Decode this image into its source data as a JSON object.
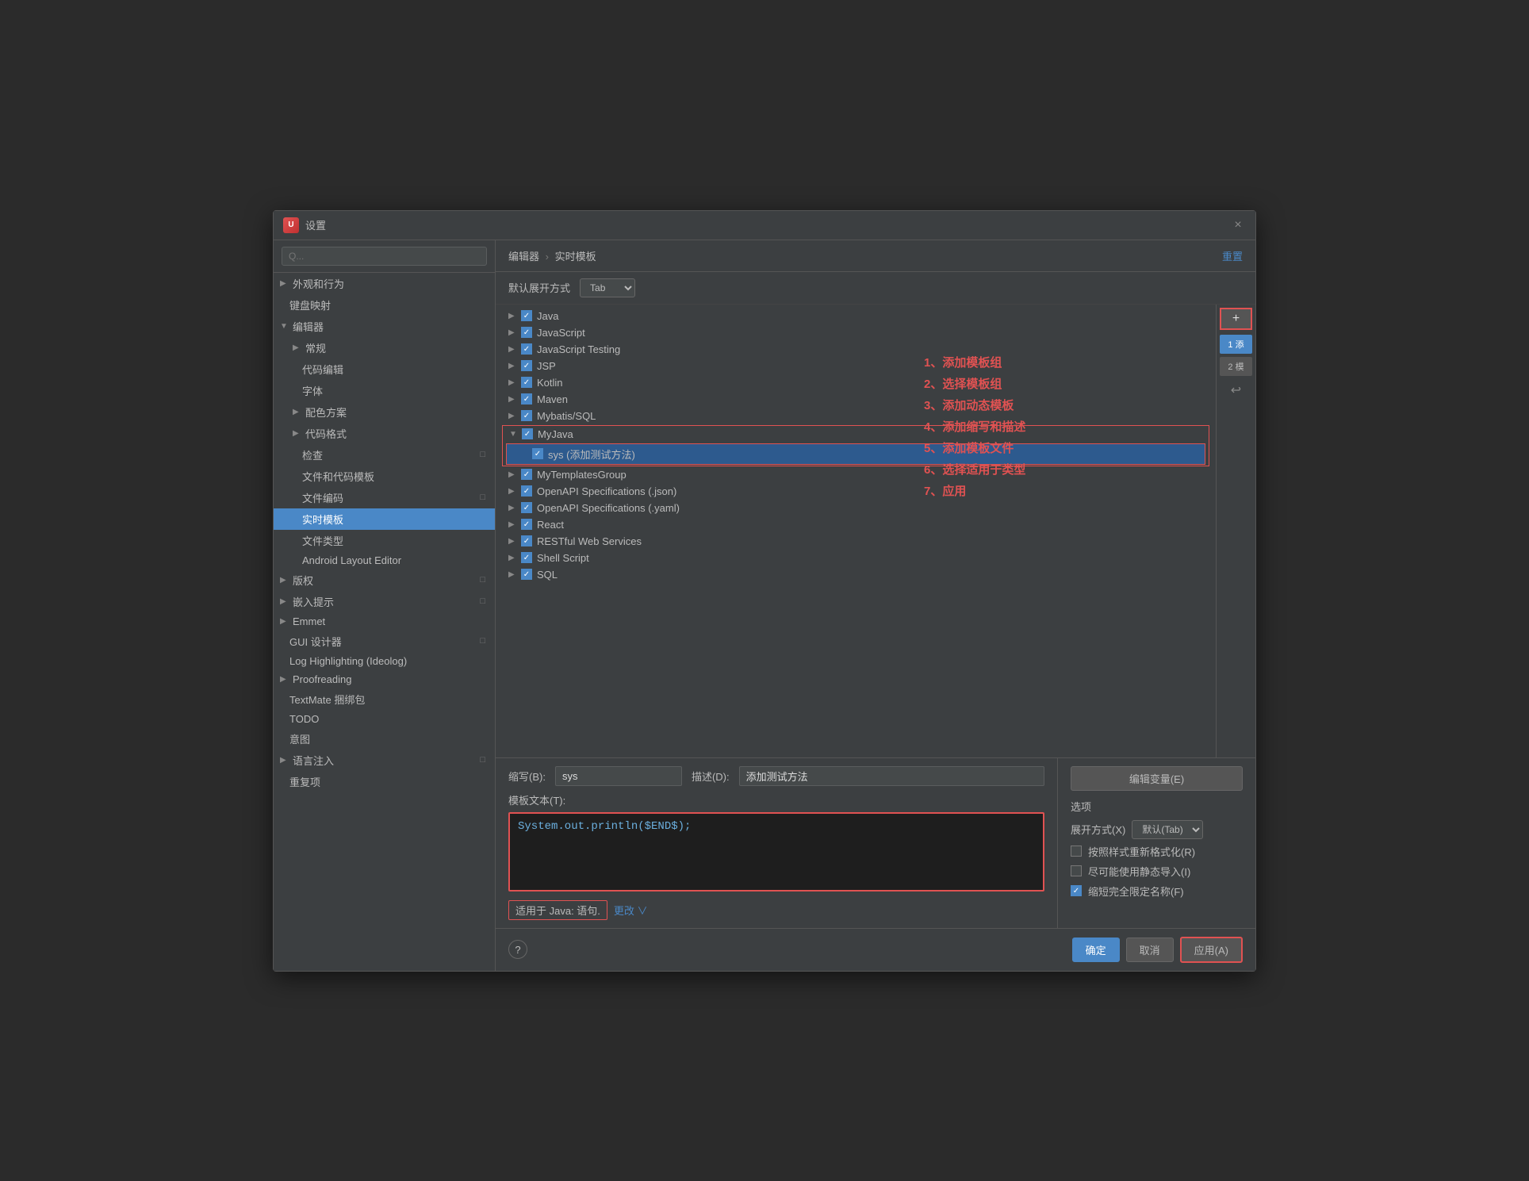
{
  "dialog": {
    "title": "设置",
    "close_label": "×"
  },
  "search": {
    "placeholder": "Q..."
  },
  "sidebar": {
    "items": [
      {
        "id": "appearance",
        "label": "外观和行为",
        "indent": 0,
        "has_chevron": true,
        "active": false
      },
      {
        "id": "keymap",
        "label": "键盘映射",
        "indent": 0,
        "has_chevron": false,
        "active": false
      },
      {
        "id": "editor",
        "label": "编辑器",
        "indent": 0,
        "has_chevron": true,
        "expanded": true,
        "active": false
      },
      {
        "id": "general",
        "label": "常规",
        "indent": 1,
        "has_chevron": true,
        "active": false
      },
      {
        "id": "code-editing",
        "label": "代码编辑",
        "indent": 1,
        "has_chevron": false,
        "active": false
      },
      {
        "id": "font",
        "label": "字体",
        "indent": 1,
        "has_chevron": false,
        "active": false
      },
      {
        "id": "color-scheme",
        "label": "配色方案",
        "indent": 1,
        "has_chevron": true,
        "active": false
      },
      {
        "id": "code-style",
        "label": "代码格式",
        "indent": 1,
        "has_chevron": true,
        "active": false
      },
      {
        "id": "inspections",
        "label": "检查",
        "indent": 1,
        "has_chevron": false,
        "active": false
      },
      {
        "id": "file-templates",
        "label": "文件和代码模板",
        "indent": 1,
        "has_chevron": false,
        "active": false
      },
      {
        "id": "file-encoding",
        "label": "文件编码",
        "indent": 1,
        "has_chevron": false,
        "active": false
      },
      {
        "id": "live-templates",
        "label": "实时模板",
        "indent": 1,
        "has_chevron": false,
        "active": true
      },
      {
        "id": "file-types",
        "label": "文件类型",
        "indent": 1,
        "has_chevron": false,
        "active": false
      },
      {
        "id": "android-layout",
        "label": "Android Layout Editor",
        "indent": 1,
        "has_chevron": false,
        "active": false
      },
      {
        "id": "copyright",
        "label": "版权",
        "indent": 0,
        "has_chevron": true,
        "active": false
      },
      {
        "id": "inlay-hints",
        "label": "嵌入提示",
        "indent": 0,
        "has_chevron": true,
        "active": false
      },
      {
        "id": "emmet",
        "label": "Emmet",
        "indent": 0,
        "has_chevron": true,
        "active": false
      },
      {
        "id": "gui-designer",
        "label": "GUI 设计器",
        "indent": 0,
        "has_chevron": false,
        "active": false
      },
      {
        "id": "log-highlighting",
        "label": "Log Highlighting (Ideolog)",
        "indent": 0,
        "has_chevron": false,
        "active": false
      },
      {
        "id": "proofreading",
        "label": "Proofreading",
        "indent": 0,
        "has_chevron": true,
        "active": false
      },
      {
        "id": "textmate",
        "label": "TextMate 捆绑包",
        "indent": 0,
        "has_chevron": false,
        "active": false
      },
      {
        "id": "todo",
        "label": "TODO",
        "indent": 0,
        "has_chevron": false,
        "active": false
      },
      {
        "id": "intention",
        "label": "意图",
        "indent": 0,
        "has_chevron": false,
        "active": false
      },
      {
        "id": "lang-injection",
        "label": "语言注入",
        "indent": 0,
        "has_chevron": true,
        "active": false
      },
      {
        "id": "reset-items",
        "label": "重复项",
        "indent": 0,
        "has_chevron": false,
        "active": false
      }
    ]
  },
  "main": {
    "breadcrumb": {
      "parent": "编辑器",
      "separator": "›",
      "current": "实时模板"
    },
    "reset_label": "重置",
    "expand_label": "默认展开方式",
    "expand_value": "Tab",
    "template_groups": [
      {
        "id": "java",
        "label": "Java",
        "checked": true,
        "expanded": false,
        "has_border": false
      },
      {
        "id": "javascript",
        "label": "JavaScript",
        "checked": true,
        "expanded": false,
        "has_border": false
      },
      {
        "id": "javascript-testing",
        "label": "JavaScript Testing",
        "checked": true,
        "expanded": false,
        "has_border": false
      },
      {
        "id": "jsp",
        "label": "JSP",
        "checked": true,
        "expanded": false,
        "has_border": false
      },
      {
        "id": "kotlin",
        "label": "Kotlin",
        "checked": true,
        "expanded": false,
        "has_border": false
      },
      {
        "id": "maven",
        "label": "Maven",
        "checked": true,
        "expanded": false,
        "has_border": false
      },
      {
        "id": "mybatis-sql",
        "label": "Mybatis/SQL",
        "checked": true,
        "expanded": false,
        "has_border": false
      },
      {
        "id": "myjava",
        "label": "MyJava",
        "checked": true,
        "expanded": true,
        "has_border": true
      },
      {
        "id": "mytemplates",
        "label": "MyTemplatesGroup",
        "checked": true,
        "expanded": false,
        "has_border": false
      },
      {
        "id": "openapi-json",
        "label": "OpenAPI Specifications (.json)",
        "checked": true,
        "expanded": false,
        "has_border": false
      },
      {
        "id": "openapi-yaml",
        "label": "OpenAPI Specifications (.yaml)",
        "checked": true,
        "expanded": false,
        "has_border": false
      },
      {
        "id": "react",
        "label": "React",
        "checked": true,
        "expanded": false,
        "has_border": false
      },
      {
        "id": "restful",
        "label": "RESTful Web Services",
        "checked": true,
        "expanded": false,
        "has_border": false
      },
      {
        "id": "shell-script",
        "label": "Shell Script",
        "checked": true,
        "expanded": false,
        "has_border": false
      },
      {
        "id": "sql",
        "label": "SQL",
        "checked": true,
        "expanded": false,
        "has_border": false
      }
    ],
    "myjava_item": {
      "label": "sys (添加测试方法)",
      "checked": true,
      "selected": true
    },
    "annotation": {
      "lines": [
        "1、添加模板组",
        "2、选择模板组",
        "3、添加动态模板",
        "4、添加缩写和描述",
        "5、添加模板文件",
        "6、选择适用于类型",
        "7、应用"
      ]
    },
    "action_buttons": {
      "add_label": "+",
      "btn1_label": "1 添",
      "btn2_label": "2 模"
    },
    "edit_section": {
      "abbr_label": "缩写(B):",
      "abbr_value": "sys",
      "desc_label": "描述(D):",
      "desc_value": "添加测试方法",
      "template_text_label": "模板文本(T):",
      "template_text_value": "System.out.println($END$);",
      "apply_context_prefix": "适用于 Java: 语句.",
      "change_label": "更改 ∨",
      "edit_variables_label": "编辑变量(E)"
    },
    "options": {
      "title": "选项",
      "expand_label": "展开方式(X)",
      "expand_value": "默认(Tab)",
      "opt1_label": "按照样式重新格式化(R)",
      "opt1_checked": false,
      "opt2_label": "尽可能使用静态导入(I)",
      "opt2_checked": false,
      "opt3_label": "缩短完全限定名称(F)",
      "opt3_checked": true
    }
  },
  "footer": {
    "help_label": "?",
    "ok_label": "确定",
    "cancel_label": "取消",
    "apply_label": "应用(A)"
  }
}
